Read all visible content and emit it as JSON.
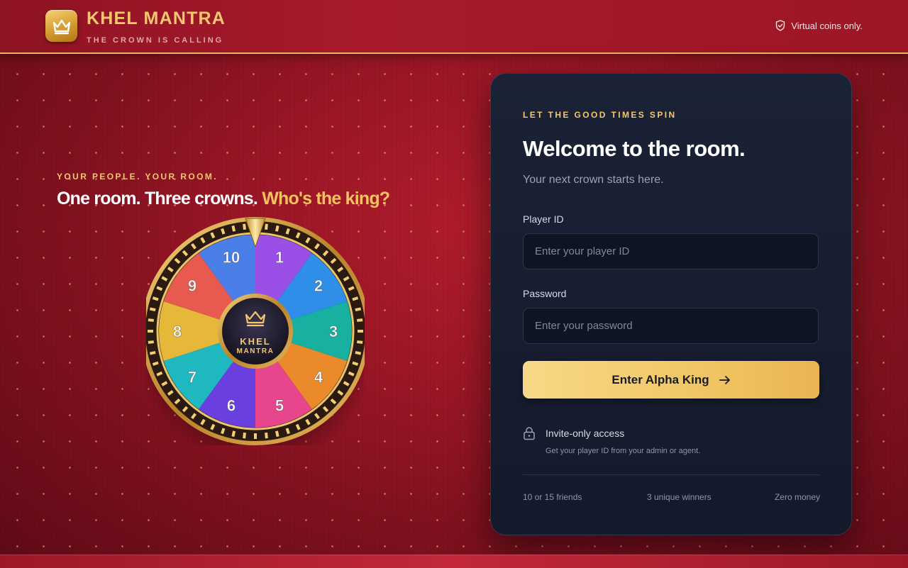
{
  "header": {
    "brand_name": "KHEL MANTRA",
    "tagline": "THE CROWN IS CALLING",
    "virtual_note": "Virtual coins only.",
    "icons": {
      "logo": "crown-icon",
      "note": "shield-check-icon"
    }
  },
  "hero": {
    "eyebrow": "YOUR PEOPLE. YOUR ROOM.",
    "title_main": "One room. Three crowns.",
    "title_accent": "Who's the king?",
    "wheel": {
      "segments": [
        {
          "label": "1",
          "color": "#9a4fe6"
        },
        {
          "label": "2",
          "color": "#2f8fe8"
        },
        {
          "label": "3",
          "color": "#18b0a0"
        },
        {
          "label": "4",
          "color": "#ea8a2a"
        },
        {
          "label": "5",
          "color": "#e8468c"
        },
        {
          "label": "6",
          "color": "#6a3fe0"
        },
        {
          "label": "7",
          "color": "#1fb8c0"
        },
        {
          "label": "8",
          "color": "#e6b83a"
        },
        {
          "label": "9",
          "color": "#e85a50"
        },
        {
          "label": "10",
          "color": "#4a7fe8"
        }
      ],
      "hub_line1": "KHEL",
      "hub_line2": "MANTRA"
    }
  },
  "login": {
    "eyebrow": "LET THE GOOD TIMES SPIN",
    "title": "Welcome to the room.",
    "subtitle": "Your next crown starts here.",
    "player_id_label": "Player ID",
    "player_id_placeholder": "Enter your player ID",
    "player_id_value": "",
    "password_label": "Password",
    "password_placeholder": "Enter your password",
    "password_value": "",
    "submit_label": "Enter Alpha King",
    "invite_title": "Invite-only access",
    "invite_sub": "Get your player ID from your admin or agent.",
    "stats": [
      "10 or 15 friends",
      "3 unique winners",
      "Zero money"
    ]
  },
  "colors": {
    "gold": "#f3c76e",
    "background_red": "#9a1626",
    "card_navy": "#161c2d",
    "button_gold": "#f1c866"
  }
}
